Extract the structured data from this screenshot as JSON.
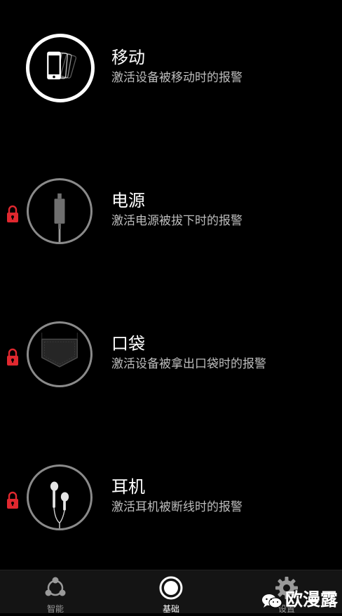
{
  "alarms": [
    {
      "title": "移动",
      "description": "激活设备被移动时的报警",
      "icon": "phone-motion-icon",
      "active": true,
      "locked": false
    },
    {
      "title": "电源",
      "description": "激活电源被拔下时的报警",
      "icon": "power-cable-icon",
      "active": false,
      "locked": true
    },
    {
      "title": "口袋",
      "description": "激活设备被拿出口袋时的报警",
      "icon": "pocket-icon",
      "active": false,
      "locked": true
    },
    {
      "title": "耳机",
      "description": "激活耳机被断线时的报警",
      "icon": "earphone-icon",
      "active": false,
      "locked": true
    }
  ],
  "tabbar": {
    "tabs": [
      {
        "label": "智能",
        "icon": "share-nodes-icon",
        "selected": false
      },
      {
        "label": "基础",
        "icon": "record-circle-icon",
        "selected": true
      },
      {
        "label": "设置",
        "icon": "gear-icon",
        "selected": false
      }
    ]
  },
  "watermark": {
    "text": "欧漫露",
    "icon": "wechat-icon"
  },
  "colors": {
    "background": "#000000",
    "lock_red": "#e0282f",
    "inactive_ring": "#8a8a8a",
    "active_ring": "#ffffff",
    "description_text": "#bdbdbd"
  }
}
